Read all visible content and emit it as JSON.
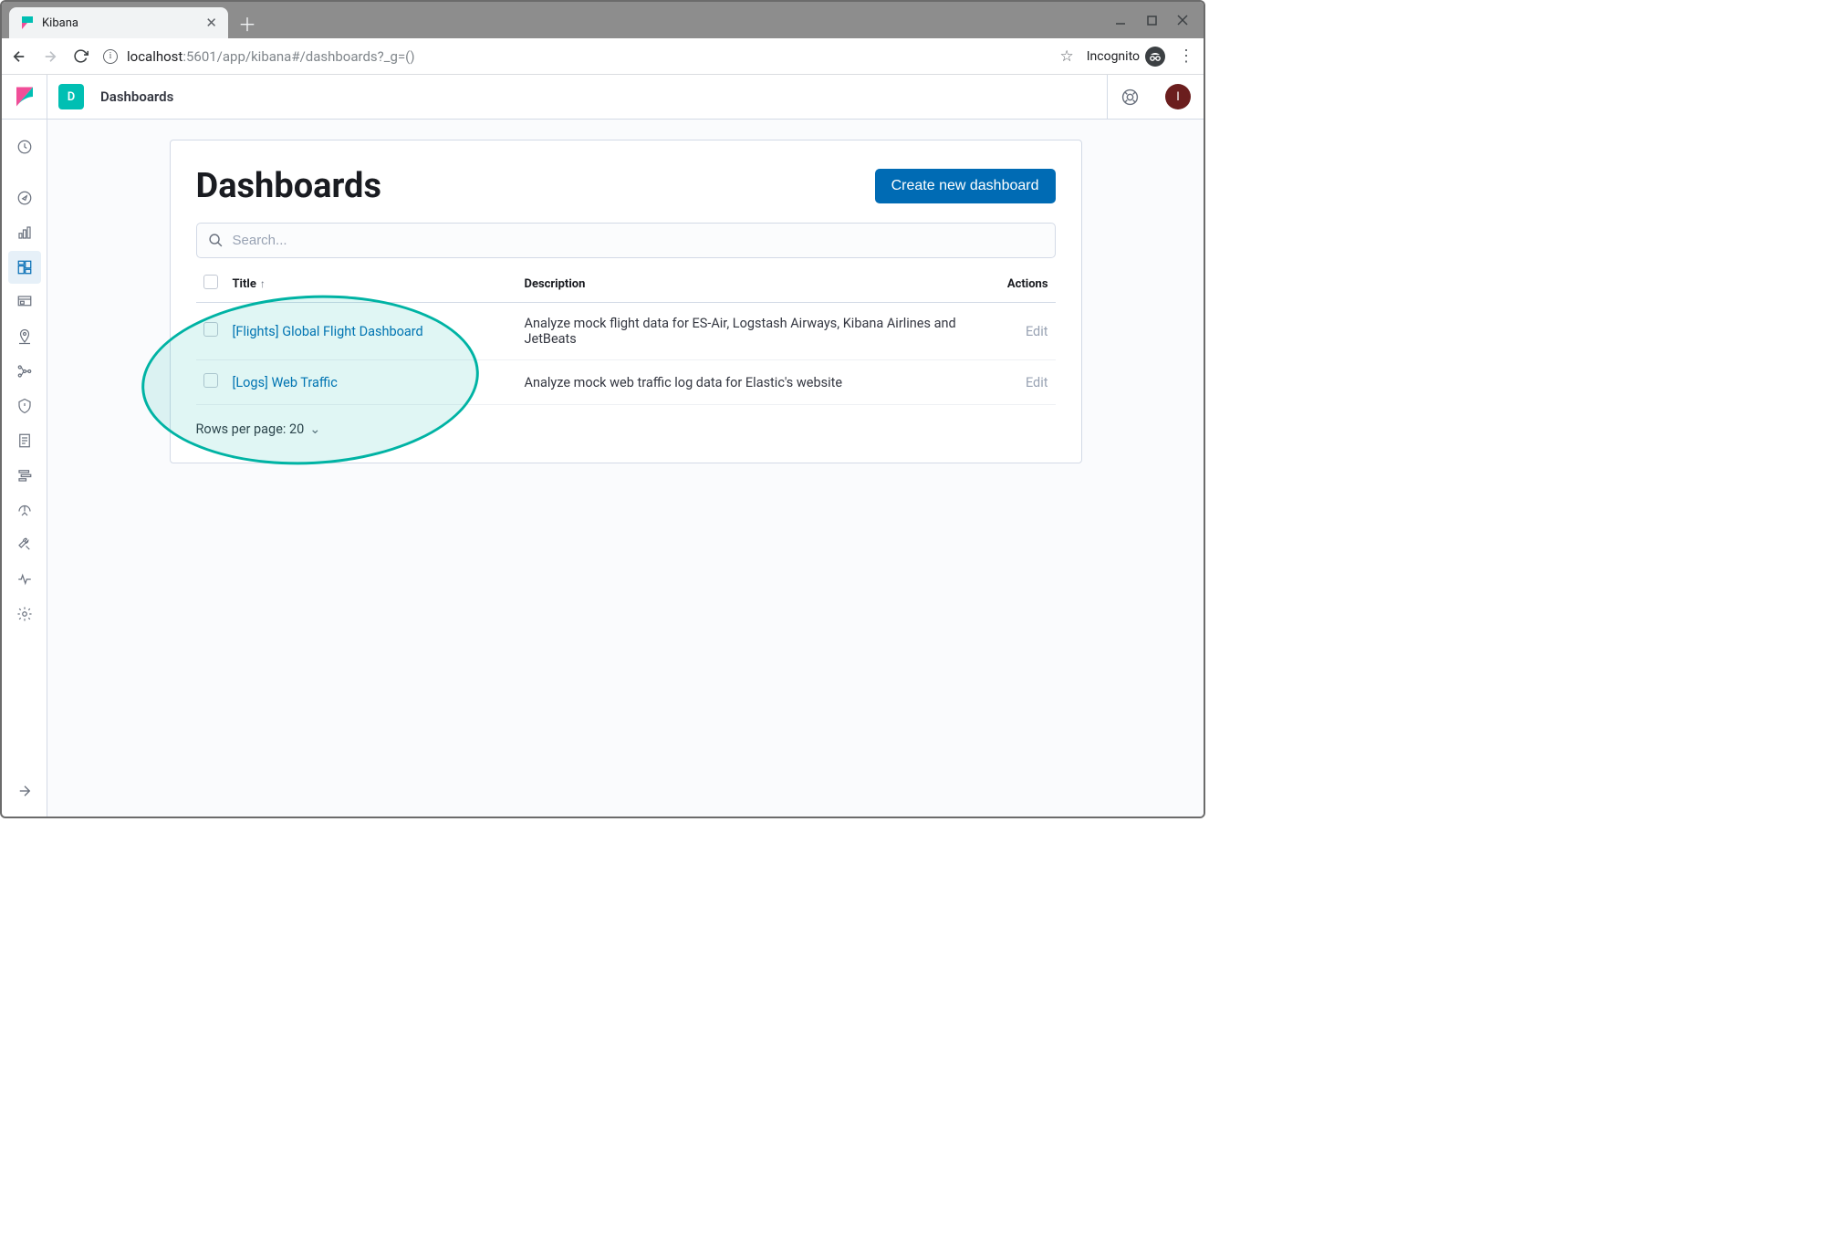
{
  "browser": {
    "tab_title": "Kibana",
    "url_host": "localhost",
    "url_path": ":5601/app/kibana#/dashboards?_g=()",
    "incognito_label": "Incognito"
  },
  "header": {
    "app_badge": "D",
    "breadcrumb": "Dashboards",
    "avatar_letter": "I"
  },
  "page": {
    "title": "Dashboards",
    "create_btn": "Create new dashboard",
    "search_placeholder": "Search...",
    "columns": {
      "title": "Title",
      "description": "Description",
      "actions": "Actions"
    },
    "rows": [
      {
        "title": "[Flights] Global Flight Dashboard",
        "description": "Analyze mock flight data for ES-Air, Logstash Airways, Kibana Airlines and JetBeats",
        "action": "Edit"
      },
      {
        "title": "[Logs] Web Traffic",
        "description": "Analyze mock web traffic log data for Elastic's website",
        "action": "Edit"
      }
    ],
    "rows_per_page_label": "Rows per page: 20"
  },
  "icons": {
    "sidenav": [
      "recent-icon",
      "discover-icon",
      "visualize-icon",
      "dashboard-icon",
      "canvas-icon",
      "maps-icon",
      "ml-icon",
      "infra-icon",
      "logs-icon",
      "apm-icon",
      "uptime-icon",
      "devtools-icon",
      "monitoring-icon",
      "management-icon"
    ]
  }
}
